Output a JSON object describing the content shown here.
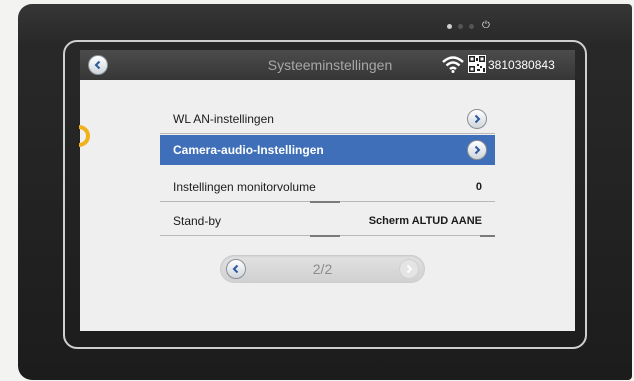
{
  "colors": {
    "accent": "#3f6fb8",
    "topbar": "#3c3c3c",
    "indicator": "#f2b01a"
  },
  "header": {
    "back_icon": "chevron-left-icon",
    "title": "Systeeminstellingen",
    "wifi_icon": "wifi-icon",
    "qr_icon": "qr-code-icon",
    "serial": "3810380843"
  },
  "settings": {
    "items": [
      {
        "label": "WL AN-instellingen",
        "value": "",
        "arrow": true,
        "selected": false
      },
      {
        "label": "Camera-audio-Instellingen",
        "value": "",
        "arrow": true,
        "selected": true
      },
      {
        "label": "Instellingen monitorvolume",
        "value": "0",
        "arrow": false,
        "selected": false
      },
      {
        "label": "Stand-by",
        "value": "Scherm ALTUD AANE",
        "arrow": false,
        "selected": false
      }
    ]
  },
  "pager": {
    "page": "2/2",
    "prev_icon": "chevron-left-icon",
    "next_icon": "chevron-right-icon"
  }
}
